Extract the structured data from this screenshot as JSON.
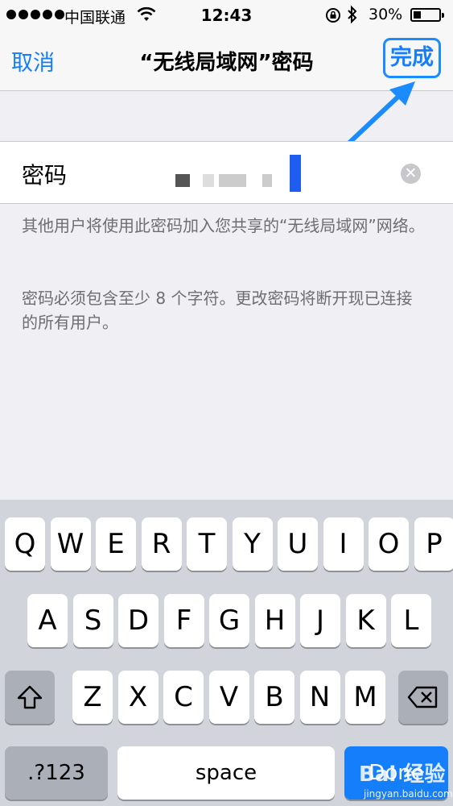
{
  "status_bar": {
    "carrier": "中国联通",
    "time": "12:43",
    "battery": "30%",
    "battery_level": 0.3,
    "icons": [
      "signal-dots-icon",
      "wifi-icon",
      "rotation-lock-icon",
      "bluetooth-icon",
      "battery-icon"
    ]
  },
  "nav": {
    "cancel_label": "取消",
    "title": "“无线局域网”密码",
    "done_label": "完成"
  },
  "password_field": {
    "label": "密码"
  },
  "notes": {
    "note1": "其他用户将使用此密码加入您共享的“无线局域网”网络。",
    "note2": "密码必须包含至少 8 个字符。更改密码将断开现已连接的所有用户。"
  },
  "keyboard": {
    "row1": [
      "Q",
      "W",
      "E",
      "R",
      "T",
      "Y",
      "U",
      "I",
      "O",
      "P"
    ],
    "row2": [
      "A",
      "S",
      "D",
      "F",
      "G",
      "H",
      "J",
      "K",
      "L"
    ],
    "row3": [
      "Z",
      "X",
      "C",
      "V",
      "B",
      "N",
      "M"
    ],
    "numbers_label": ".?123",
    "space_label": "space",
    "done_label": "Done"
  },
  "watermark": {
    "text": "Bai 经验",
    "url": "jingyan.baidu.com"
  },
  "colors": {
    "accent": "#147efb",
    "annotation": "#1a8cff"
  }
}
